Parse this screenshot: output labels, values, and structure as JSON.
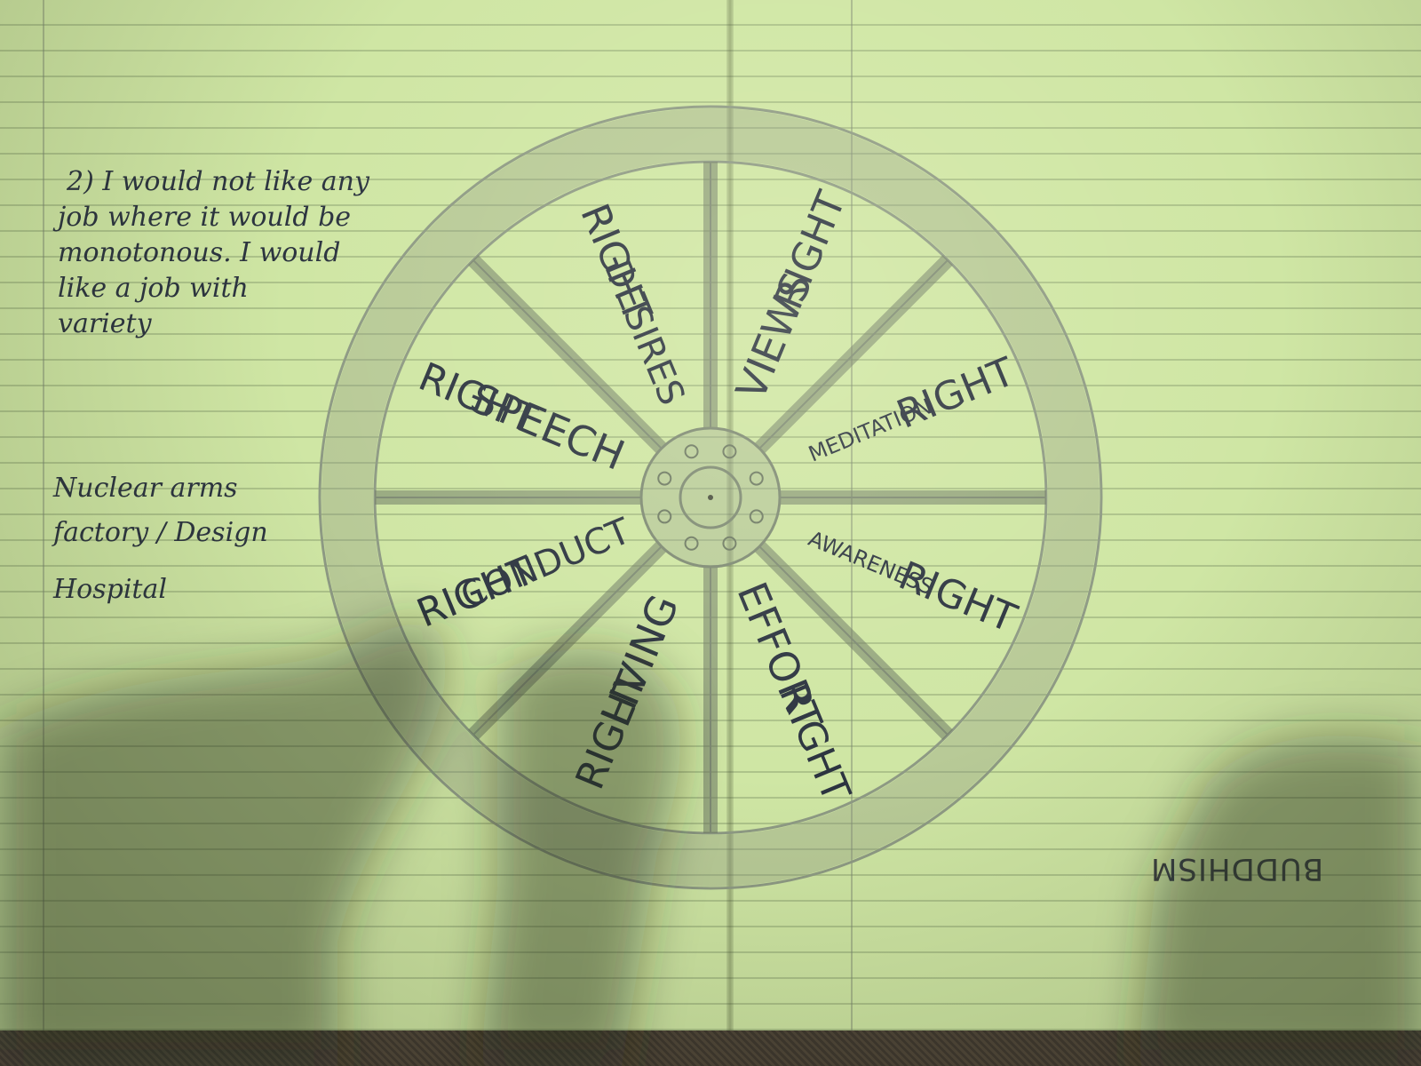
{
  "notes": {
    "lines": [
      "2) I would not like any",
      "job where it would be",
      "monotonous. I would",
      "like a job with",
      "variety"
    ]
  },
  "jobs": {
    "lines": [
      "Nuclear arms",
      "factory / Design",
      "Hospital"
    ]
  },
  "wheel": {
    "segments": [
      {
        "top": "RIGHT",
        "bottom": "VIEWS"
      },
      {
        "top": "RIGHT",
        "bottom": "MEDITATION"
      },
      {
        "top": "RIGHT",
        "bottom": "AWARENESS"
      },
      {
        "top": "RIGHT",
        "bottom": "EFFORT"
      },
      {
        "top": "RIGHT",
        "bottom": "LIVING"
      },
      {
        "top": "RIGHT",
        "bottom": "CONDUCT"
      },
      {
        "top": "RIGHT",
        "bottom": "SPEECH"
      },
      {
        "top": "RIGHT",
        "bottom": "DESIRES"
      }
    ]
  },
  "footer": {
    "title": "BUDDHISM"
  }
}
